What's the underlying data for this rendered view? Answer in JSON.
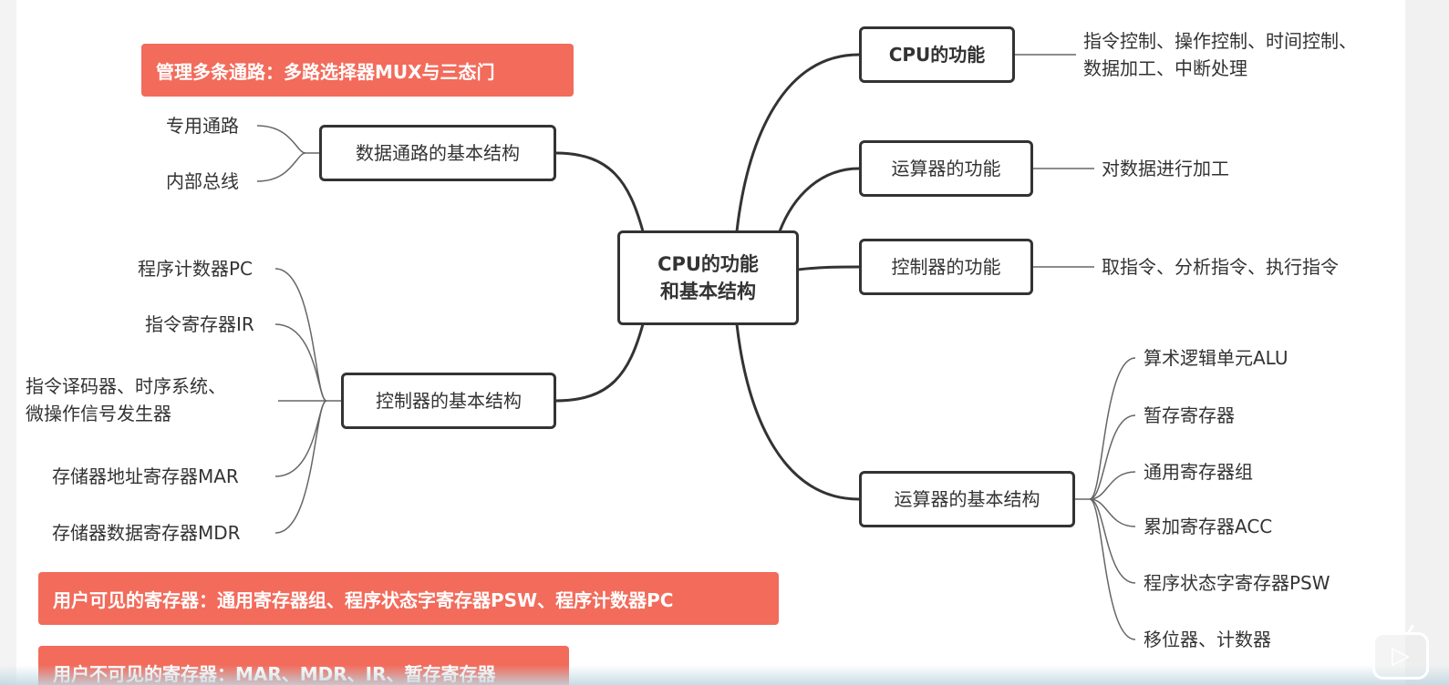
{
  "root": {
    "line1": "CPU的功能",
    "line2": "和基本结构"
  },
  "right_branches": [
    {
      "label": "CPU的功能",
      "detail": [
        "指令控制、操作控制、时间控制、",
        "数据加工、中断处理"
      ]
    },
    {
      "label": "运算器的功能",
      "detail": [
        "对数据进行加工"
      ]
    },
    {
      "label": "控制器的功能",
      "detail": [
        "取指令、分析指令、执行指令"
      ]
    },
    {
      "label": "运算器的基本结构",
      "children": [
        "算术逻辑单元ALU",
        "暂存寄存器",
        "通用寄存器组",
        "累加寄存器ACC",
        "程序状态字寄存器PSW",
        "移位器、计数器"
      ]
    }
  ],
  "left_branches": [
    {
      "label": "数据通路的基本结构",
      "children": [
        "专用通路",
        "内部总线"
      ]
    },
    {
      "label": "控制器的基本结构",
      "children": [
        "程序计数器PC",
        "指令寄存器IR",
        [
          "指令译码器、时序系统、",
          "微操作信号发生器"
        ],
        "存储器地址寄存器MAR",
        "存储器数据寄存器MDR"
      ]
    }
  ],
  "banners": {
    "mux": "管理多条通路：多路选择器MUX与三态门",
    "visible": "用户可见的寄存器：通用寄存器组、程序状态字寄存器PSW、程序计数器PC",
    "invisible": "用户不可见的寄存器：MAR、MDR、IR、暂存寄存器"
  },
  "colors": {
    "line": "#333333",
    "thin_line": "#666666",
    "banner": "#f26b5b"
  },
  "icons": {
    "player_badge": "play-icon"
  }
}
